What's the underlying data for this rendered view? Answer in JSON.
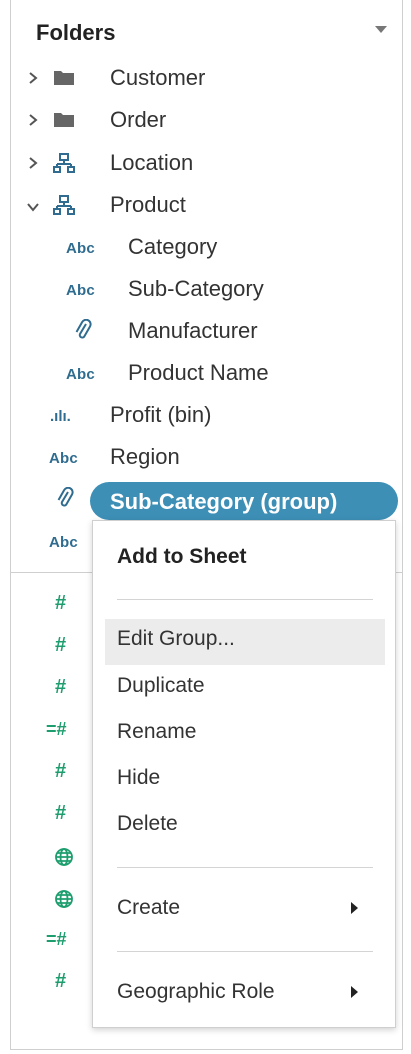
{
  "panel": {
    "title": "Folders"
  },
  "tree": [
    {
      "id": "customer",
      "label": "Customer",
      "icon": "folder-icon"
    },
    {
      "id": "order",
      "label": "Order",
      "icon": "folder-icon"
    },
    {
      "id": "location",
      "label": "Location",
      "icon": "hierarchy-icon"
    },
    {
      "id": "product",
      "label": "Product",
      "icon": "hierarchy-icon"
    },
    {
      "id": "category",
      "label": "Category",
      "icon_text": "Abc"
    },
    {
      "id": "sub-category",
      "label": "Sub-Category",
      "icon_text": "Abc"
    },
    {
      "id": "manufacturer",
      "label": "Manufacturer",
      "icon": "paperclip-icon"
    },
    {
      "id": "product-name",
      "label": "Product Name",
      "icon_text": "Abc"
    },
    {
      "id": "profit-bin",
      "label": "Profit (bin)",
      "icon_text": ".ılı."
    },
    {
      "id": "region",
      "label": "Region",
      "icon_text": "Abc"
    },
    {
      "id": "sub-category-group",
      "label": "Sub-Category (group)",
      "icon": "paperclip-icon",
      "selected": true
    }
  ],
  "partial_rows": {
    "abc_text": "Abc",
    "hash_text": "#",
    "measure_hash_text": "=#"
  },
  "context_menu": {
    "add_to_sheet": "Add to Sheet",
    "edit_group": "Edit Group...",
    "duplicate": "Duplicate",
    "rename": "Rename",
    "hide": "Hide",
    "delete": "Delete",
    "create": "Create",
    "geographic_role": "Geographic Role"
  },
  "colors": {
    "selection": "#3d8fb6",
    "dimension": "#2f6c8f",
    "measure": "#1e9e6e"
  }
}
